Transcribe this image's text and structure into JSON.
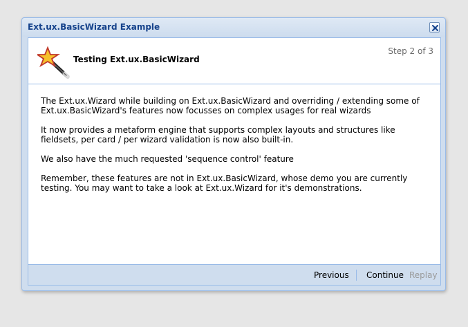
{
  "window": {
    "title": "Ext.ux.BasicWizard Example",
    "close_icon": "close-icon"
  },
  "header": {
    "icon": "magic-wand-icon",
    "title": "Testing Ext.ux.BasicWizard",
    "step": "Step 2 of 3"
  },
  "content": {
    "paragraphs": [
      "The Ext.ux.Wizard while building on Ext.ux.BasicWizard and overriding / extending some of Ext.ux.BasicWizard's features now focusses on complex usages for real wizards",
      "It now provides a metaform engine that supports complex layouts and structures like fieldsets, per card / per wizard validation is now also built-in.",
      "We also have the much requested 'sequence control' feature",
      "Remember, these features are not in Ext.ux.BasicWizard, whose demo you are currently testing. You may want to take a look at Ext.ux.Wizard for it's demonstrations."
    ]
  },
  "footer": {
    "previous_label": "Previous",
    "continue_label": "Continue",
    "replay_label": "Replay"
  },
  "colors": {
    "title_text": "#15428b",
    "border": "#99bbe8",
    "panel_bg": "#cfddee",
    "disabled_text": "#9a9a9a"
  }
}
